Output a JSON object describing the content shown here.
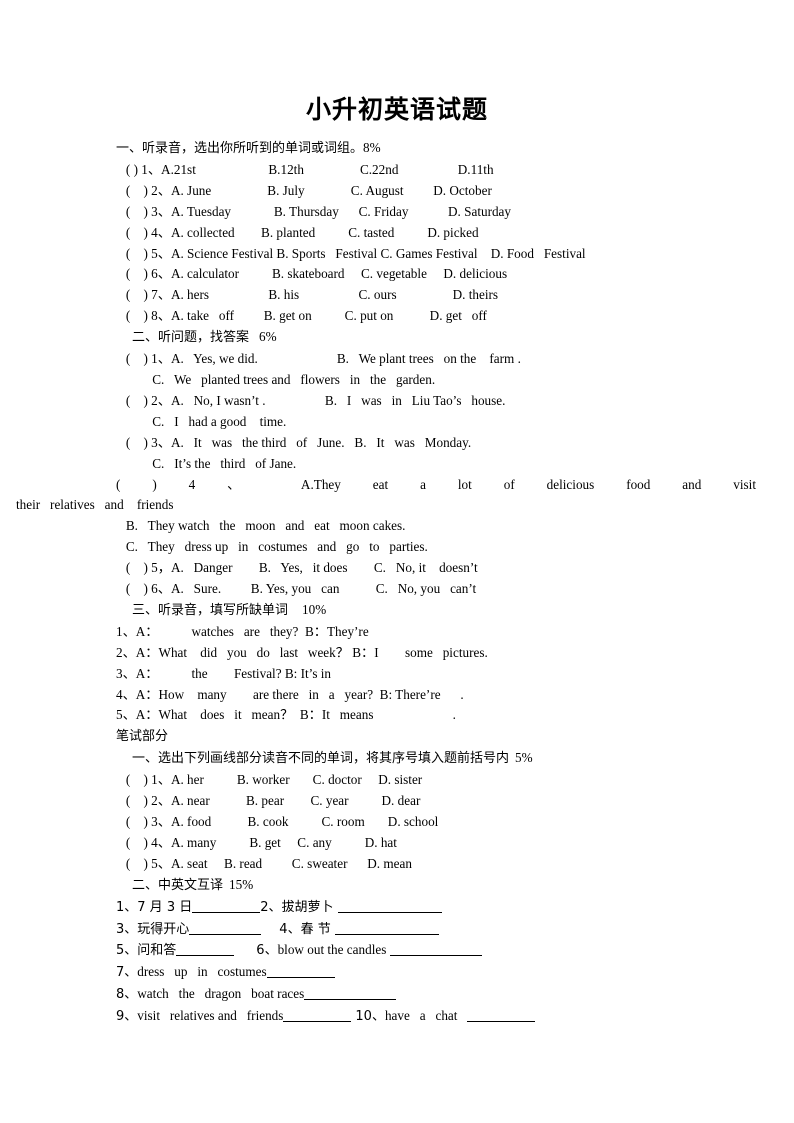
{
  "document": {
    "title": "小升初英语试题",
    "sections": [
      {
        "id": "listening-1",
        "heading": "一、听录音，选出你所听到的单词或词组。",
        "score": "8%",
        "lines": [
          "   ( ) 1、A.21st                      B.12th                 C.22nd                  D.11th",
          "   (    ) 2、A. June                 B. July              C. August         D. October",
          "   (    ) 3、A. Tuesday             B. Thursday      C. Friday            D. Saturday",
          "   (    ) 4、A. collected        B. planted          C. tasted          D. picked",
          "   (    ) 5、A. Science Festival B. Sports   Festival C. Games Festival    D. Food   Festival",
          "   (    ) 6、A. calculator          B. skateboard     C. vegetable     D. delicious",
          "   (    ) 7、A. hers                  B. his                  C. ours                 D. theirs",
          "   (    ) 8、A. take   off         B. get on          C. put on           D. get   off"
        ]
      },
      {
        "id": "listening-2",
        "heading": "二、听问题，找答案",
        "score": "6%",
        "lines": [
          "   (    ) 1、A.   Yes, we did.                        B.   We plant trees   on the    farm .",
          "           C.   We   planted trees and   flowers   in   the   garden.",
          "   (    ) 2、A.   No, I wasn’t .                  B.   I   was   in   Liu Tao’s   house.",
          "           C.   I   had a good    time."
        ],
        "lines2": [
          "   (    ) 3、A.   It   was   the third   of   June.   B.   It   was   Monday.",
          "           C.   It’s the   third   of Jane."
        ],
        "justified4": "(          )  4  、  A.They      eat      a      lot      of      delicious      food      and      visit",
        "cont4": "their   relatives   and    friends",
        "lines3": [
          "   B.   They watch   the   moon   and   eat   moon cakes.",
          "   C.   They   dress up   in   costumes   and   go   to   parties.",
          "   (    ) 5，A.   Danger        B.   Yes,   it does        C.   No, it    doesn’t",
          "   (    ) 6、A.   Sure.         B. Yes, you   can           C.   No, you   can’t"
        ]
      },
      {
        "id": "listening-3",
        "heading": "三、听录音，填写所缺单词",
        "score": "10%",
        "lines": [
          "1、A：          watches   are   they?  B：They’re",
          "2、A：What    did   you   do   last   week？ B：I        some   pictures.",
          "3、A：          the        Festival? B: It’s in",
          "4、A：How    many        are there   in   a   year?  B: There’re      .",
          "5、A：What    does   it   mean？  B：It   means                        ."
        ]
      },
      {
        "id": "written-part",
        "label": "笔试部分"
      },
      {
        "id": "written-1",
        "heading": "一、选出下列画线部分读音不同的单词，将其序号填入题前括号内",
        "score": "5%",
        "lines": [
          "   (    ) 1、A. her          B. worker       C. doctor     D. sister",
          "   (    ) 2、A. near           B. pear        C. year          D. dear",
          "   (    ) 3、A. food           B. cook          C. room       D. school",
          "   (    ) 4、A. many          B. get     C. any          D. hat",
          "   (    ) 5、A. seat     B. read         C. sweater      D. mean"
        ]
      },
      {
        "id": "written-2",
        "heading": "二、中英文互译",
        "score": "15%",
        "translation_items": [
          {
            "no": "1、",
            "text": "7 月 3 日",
            "blank_width": 68,
            "tail": ""
          },
          {
            "no": "2、",
            "text": "拔胡萝卜 ",
            "blank_width": 104,
            "tail": ""
          },
          {
            "no": "3、",
            "text": "玩得开心",
            "blank_width": 72,
            "tail": ""
          },
          {
            "no": "4、",
            "text": "春 节 ",
            "blank_width": 104,
            "tail": ""
          },
          {
            "no": "5、",
            "text": "问和答",
            "blank_width": 58,
            "tail": ""
          },
          {
            "no": "6、",
            "text": "blow out the candles ",
            "blank_width": 92,
            "tail": ""
          },
          {
            "no": "7、",
            "text": "dress   up   in   costumes",
            "blank_width": 68,
            "tail": ""
          },
          {
            "no": "8、",
            "text": "watch   the   dragon   boat races",
            "blank_width": 92,
            "tail": ""
          },
          {
            "no": "9、",
            "text": "visit   relatives and   friends",
            "blank_width": 68,
            "tail": ""
          },
          {
            "no": "10、",
            "text": "have   a   chat   ",
            "blank_width": 68,
            "tail": ""
          }
        ]
      }
    ]
  }
}
